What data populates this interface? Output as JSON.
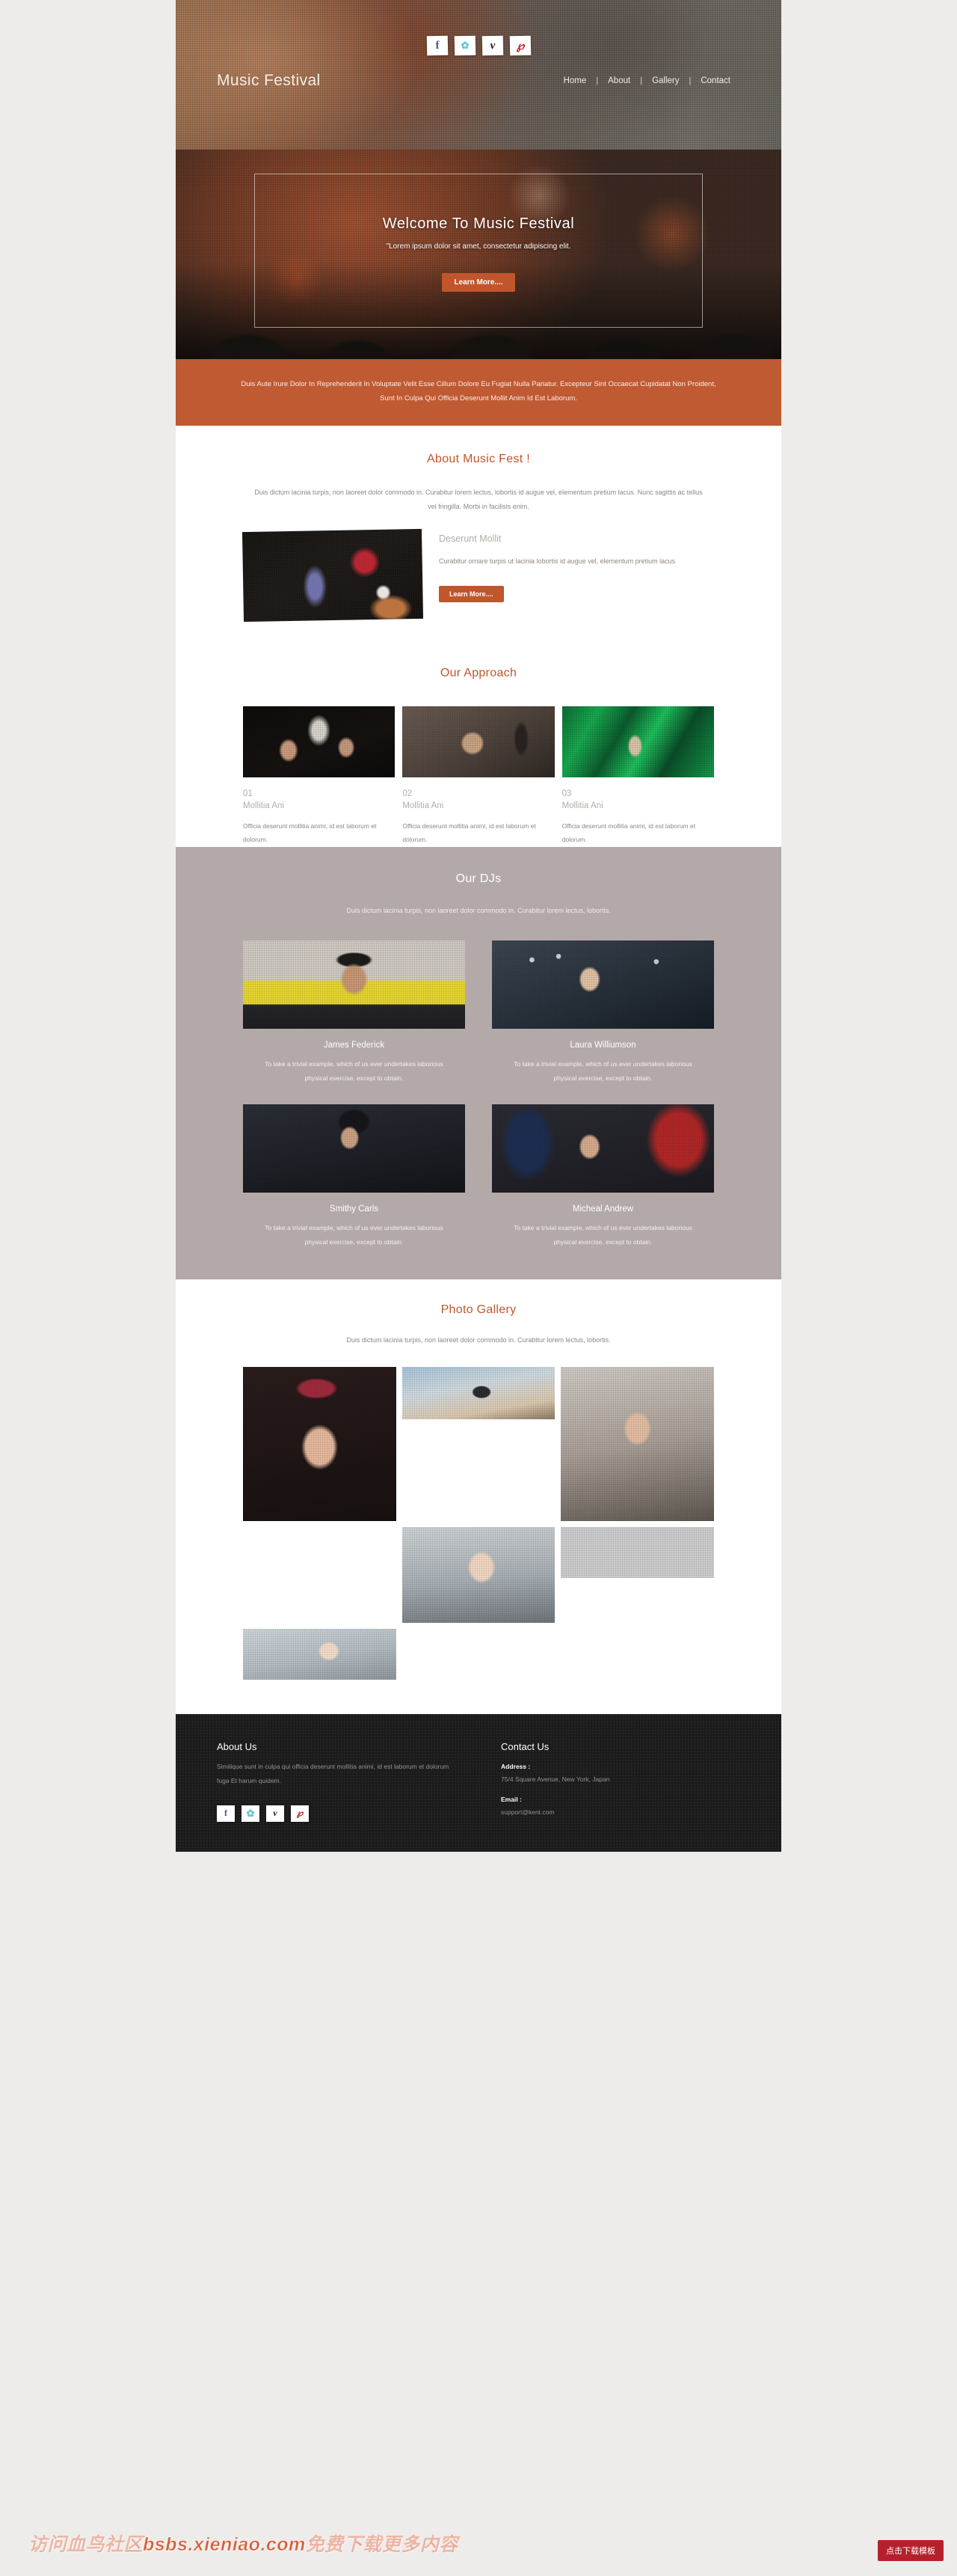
{
  "site": {
    "brand": "Music Festival",
    "accent": "#c1562c",
    "banner_bg": "#bf5a33",
    "dj_bg": "#b3a9a9",
    "footer_bg": "#1b1b1b"
  },
  "header": {
    "social": [
      {
        "name": "facebook-icon",
        "glyph": "f"
      },
      {
        "name": "twitter-icon",
        "glyph": "✿"
      },
      {
        "name": "vimeo-icon",
        "glyph": "v"
      },
      {
        "name": "pinterest-icon",
        "glyph": "℘"
      }
    ],
    "nav": [
      {
        "label": "Home"
      },
      {
        "label": "About"
      },
      {
        "label": "Gallery"
      },
      {
        "label": "Contact"
      }
    ],
    "separator": "|"
  },
  "hero": {
    "title": "Welcome To Music Festival",
    "subtitle": "\"Lorem ipsum dolor sit amet, consectetur adipiscing elit.",
    "cta": "Learn More...."
  },
  "banner": {
    "text": "Duis Aute Irure Dolor In Reprehenderit In Voluptate Velit Esse Cillum Dolore Eu Fugiat Nulla Pariatur. Excepteur Sint Occaecat Cupidatat Non Proident, Sunt In Culpa Qui Officia Deserunt Mollit Anim Id Est Laborum."
  },
  "about": {
    "title": "About Music Fest !",
    "lead": "Duis dictum lacinia turpis, non laoreet dolor commodo in. Curabitur lorem lectus, lobortis id augue vel, elementum pretium lacus. Nunc sagittis ac tellus vel fringilla. Morbi in facilisis enim.",
    "subtitle": "Deserunt Mollit",
    "body": "Curabitur ornare turpis ut lacinia lobortis id augue vel, elementum pretium lacus",
    "cta": "Learn More...."
  },
  "approach": {
    "title": "Our Approach",
    "cards": [
      {
        "num": "01",
        "name": "Mollitia Ani",
        "text": "Officia deserunt mollitia animi, id est laborum et dolorum."
      },
      {
        "num": "02",
        "name": "Mollitia Ani",
        "text": "Officia deserunt mollitia animi, id est laborum et dolorum."
      },
      {
        "num": "03",
        "name": "Mollitia Ani",
        "text": "Officia deserunt mollitia animi, id est laborum et dolorum."
      }
    ]
  },
  "djs": {
    "title": "Our DJs",
    "lead": "Duis dictum lacinia turpis, non laoreet dolor commodo in. Curabitur lorem lectus, lobortis.",
    "members": [
      {
        "name": "James Federick",
        "text": "To take a trivial example, which of us ever undertakes laborious physical exercise, except to obtain."
      },
      {
        "name": "Laura Williumson",
        "text": "To take a trivial example, which of us ever undertakes laborious physical exercise, except to obtain."
      },
      {
        "name": "Smithy Carls",
        "text": "To take a trivial example, which of us ever undertakes laborious physical exercise, except to obtain."
      },
      {
        "name": "Micheal Andrew",
        "text": "To take a trivial example, which of us ever undertakes laborious physical exercise, except to obtain."
      }
    ]
  },
  "gallery": {
    "title": "Photo Gallery",
    "lead": "Duis dictum lacinia turpis, non laoreet dolor commodo in. Curabitur lorem lectus, lobortis."
  },
  "footer": {
    "about_title": "About Us",
    "about_text": "Similique sunt in culpa qui officia deserunt mollitia animi, id est laborum et dolorum fuga Et harum quidem.",
    "contact_title": "Contact Us",
    "address_label": "Address :",
    "address_value": "75/4 Square Avenue, New York, Japan",
    "email_label": "Email :",
    "email_value": "support@kent.com",
    "social": [
      {
        "name": "facebook-icon",
        "glyph": "f"
      },
      {
        "name": "twitter-icon",
        "glyph": "✿"
      },
      {
        "name": "vimeo-icon",
        "glyph": "v"
      },
      {
        "name": "pinterest-icon",
        "glyph": "℘"
      }
    ]
  },
  "watermark": {
    "text": "访问血鸟社区bsbs.xieniao.com免费下载更多内容",
    "button": "点击下载模板"
  }
}
